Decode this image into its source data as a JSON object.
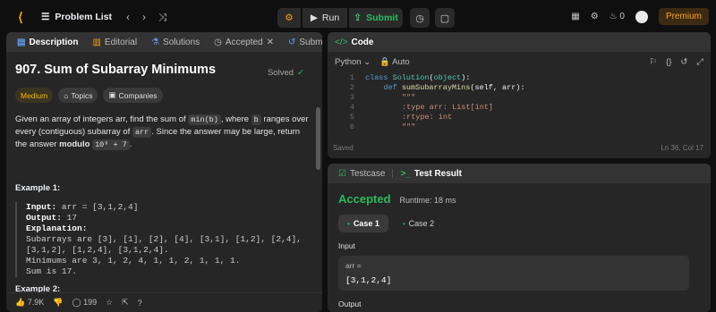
{
  "topbar": {
    "problem_list": "Problem List",
    "run": "Run",
    "submit": "Submit",
    "streak": "0",
    "premium": "Premium"
  },
  "left_tabs": [
    "Description",
    "Editorial",
    "Solutions",
    "Accepted",
    "Submissions"
  ],
  "problem": {
    "title": "907. Sum of Subarray Minimums",
    "status": "Solved",
    "tags": [
      "Medium",
      "Topics",
      "Companies"
    ],
    "desc_p1": "Given an array of integers arr, find the sum of ",
    "code_minb": "min(b)",
    "desc_p2": ", where ",
    "code_b": "b",
    "desc_p3": " ranges over every (contiguous) subarray of ",
    "code_arr": "arr",
    "desc_p4": ". Since the answer may be large, return the answer ",
    "modulo": "modulo",
    "mod_code": "10⁹ + 7",
    "desc_p5": ".",
    "example_title": "Example 1:",
    "ex_input_label": "Input:",
    "ex_input": " arr = [3,1,2,4]",
    "ex_output_label": "Output:",
    "ex_output": " 17",
    "ex_expl_label": "Explanation:",
    "ex_expl_lines": [
      "Subarrays are [3], [1], [2], [4], [3,1], [1,2], [2,4],",
      "[3,1,2], [1,2,4], [3,1,2,4].",
      "Minimums are 3, 1, 2, 4, 1, 1, 2, 1, 1, 1.",
      "Sum is 17."
    ],
    "example2_title": "Example 2:"
  },
  "footer": {
    "likes": "7.9K",
    "comments": "199"
  },
  "code": {
    "title": "Code",
    "language": "Python",
    "autosave": "Auto",
    "saved": "Saved",
    "position": "Ln 36, Col 17",
    "lines": [
      {
        "n": "1",
        "t": ""
      },
      {
        "n": "2",
        "t": ""
      },
      {
        "n": "3",
        "t": "\"\"\""
      },
      {
        "n": "4",
        "t": ":type arr: List[int]"
      },
      {
        "n": "5",
        "t": ":rtype: int"
      },
      {
        "n": "6",
        "t": "\"\"\""
      }
    ]
  },
  "result": {
    "tab_testcase": "Testcase",
    "tab_result": "Test Result",
    "status": "Accepted",
    "runtime": "Runtime: 18 ms",
    "cases": [
      "Case 1",
      "Case 2"
    ],
    "input_label": "Input",
    "var_name": "arr =",
    "var_value": "[3,1,2,4]",
    "output_label": "Output"
  },
  "colors": {
    "accent": "#ffa116",
    "success": "#2cbb5d",
    "medium": "#ffb800"
  }
}
